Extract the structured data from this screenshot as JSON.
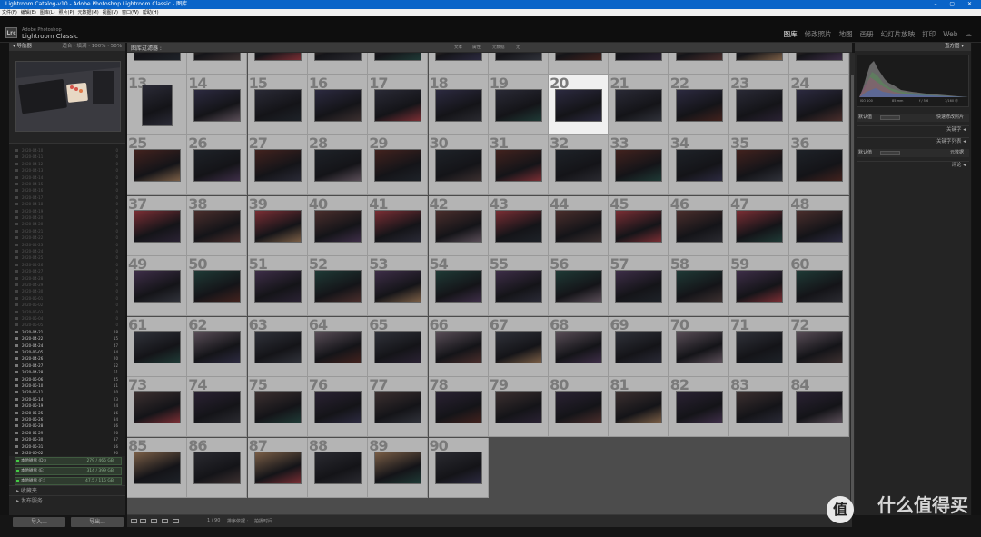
{
  "window": {
    "title": "Lightroom Catalog-v10 - Adobe Photoshop Lightroom Classic - 图库",
    "controls": "– ▢ ✕"
  },
  "menu": [
    "文件(F)",
    "编辑(E)",
    "图库(L)",
    "照片(P)",
    "元数据(M)",
    "视图(V)",
    "窗口(W)",
    "帮助(H)"
  ],
  "brand": {
    "logo": "Lrc",
    "line1": "Adobe Photoshop",
    "line2": "Lightroom Classic"
  },
  "modules": [
    "图库",
    "修改照片",
    "地图",
    "画册",
    "幻灯片放映",
    "打印",
    "Web"
  ],
  "left": {
    "navigator": {
      "title": "导航器",
      "zoom": "适合 ‧ 填满 ‧ 100% ‧ 50%"
    },
    "tree_dim": [
      "2020-04-10",
      "2020-04-11",
      "2020-04-12",
      "2020-04-13",
      "2020-04-14",
      "2020-04-15",
      "2020-04-16",
      "2020-04-17",
      "2020-04-18",
      "2020-04-19",
      "2020-04-20",
      "2020-04-20",
      "2020-04-21",
      "2020-04-22",
      "2020-04-23",
      "2020-04-24",
      "2020-04-25",
      "2020-04-26",
      "2020-04-27",
      "2020-04-28",
      "2020-04-29",
      "2020-04-30",
      "2020-05-01",
      "2020-05-02",
      "2020-05-03",
      "2020-05-04",
      "2020-05-05"
    ],
    "tree": [
      [
        "2020-04-21",
        "28"
      ],
      [
        "2020-04-22",
        "15"
      ],
      [
        "2020-04-24",
        "47"
      ],
      [
        "2020-05-05",
        "34"
      ],
      [
        "2020-04-26",
        "20"
      ],
      [
        "2020-04-27",
        "52"
      ],
      [
        "2020-04-28",
        "61"
      ],
      [
        "2020-05-06",
        "45"
      ],
      [
        "2020-05-10",
        "11"
      ],
      [
        "2020-05-11",
        "20"
      ],
      [
        "2020-05-14",
        "23"
      ],
      [
        "2020-05-19",
        "24"
      ],
      [
        "2020-05-25",
        "16"
      ],
      [
        "2020-05-26",
        "34"
      ],
      [
        "2020-05-28",
        "16"
      ],
      [
        "2020-05-29",
        "90"
      ],
      [
        "2020-05-30",
        "37"
      ],
      [
        "2020-05-31",
        "16"
      ],
      [
        "2020-06-02",
        "90"
      ]
    ],
    "volumes": [
      [
        "本地磁盘 (D:)",
        "279 / 465 GB"
      ],
      [
        "本地磁盘 (E:)",
        "314 / 399 GB"
      ],
      [
        "本地磁盘 (F:)",
        "47.5 / 115 GB"
      ]
    ],
    "sections": [
      "收藏夹",
      "发布服务"
    ],
    "import": "导入...",
    "export": "导出..."
  },
  "filter": {
    "title": "图库过滤器 :",
    "tabs": [
      "文本",
      "属性",
      "元数据",
      "无"
    ]
  },
  "grid": {
    "selected": "20",
    "colors": [
      "#7a5e46",
      "#5a4e58",
      "#7a2e34",
      "#2c2a40",
      "#2a2233",
      "#3e2e48",
      "#1e2228",
      "#2a2a30",
      "#30323a",
      "#4a2e2c",
      "#2a2a36",
      "#3c3030",
      "#1f3a36",
      "#42221e"
    ]
  },
  "toolbar": {
    "sort": "排序依据 :",
    "sortval": "拍摄时间",
    "nav": "1 / 90"
  },
  "right": {
    "histogram": {
      "title": "直方图",
      "iso": "ISO 100",
      "focal": "85 mm",
      "aperture": "f / 5.6",
      "shutter": "1/160 秒"
    },
    "saved_preset": "默认值",
    "panels": [
      "快速修改照片",
      "关键字",
      "关键字列表",
      "元数据",
      "评论"
    ],
    "meta_preset": "默认值"
  },
  "watermark": {
    "logo": "值",
    "text": "什么值得买"
  }
}
